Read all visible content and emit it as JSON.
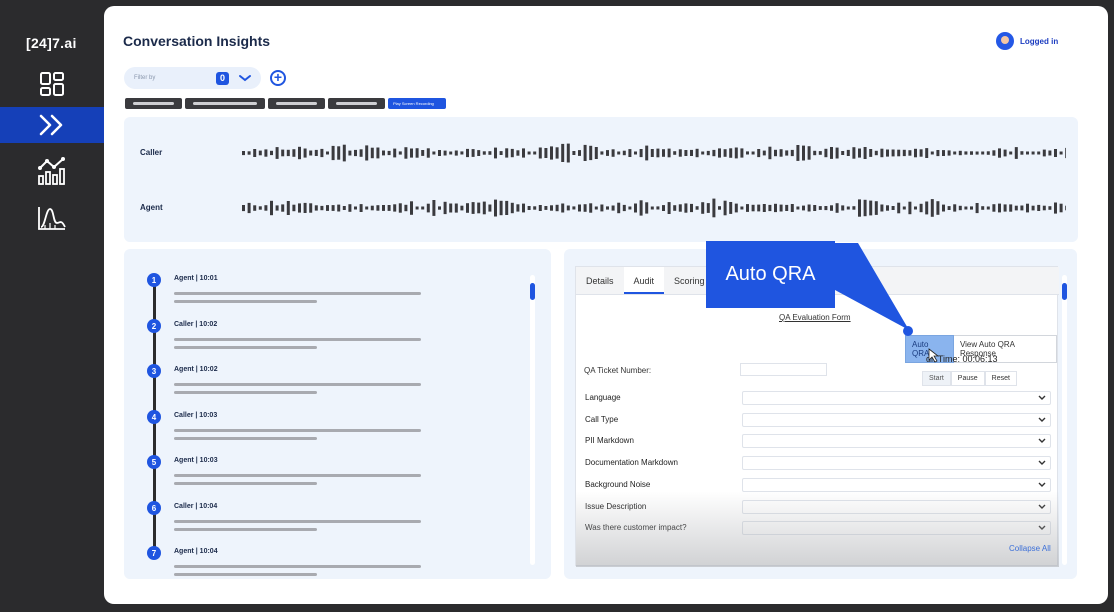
{
  "app": {
    "logo": "[24]7.ai"
  },
  "sidebar": {
    "items": [
      {
        "name": "dashboard",
        "icon": "grid-icon"
      },
      {
        "name": "conversations",
        "icon": "double-chevron-icon",
        "active": true
      },
      {
        "name": "analytics",
        "icon": "chart-trend-icon"
      },
      {
        "name": "distribution",
        "icon": "curve-chart-icon"
      }
    ]
  },
  "header": {
    "title": "Conversation Insights",
    "user_status": "Logged in"
  },
  "filter": {
    "label": "Filter by",
    "count": "0"
  },
  "chips": {
    "primary_label": "Play Screen Recording"
  },
  "waveform": {
    "caller_label": "Caller",
    "agent_label": "Agent"
  },
  "transcript": {
    "items": [
      {
        "num": "1",
        "speaker": "Agent | 10:01"
      },
      {
        "num": "2",
        "speaker": "Caller | 10:02"
      },
      {
        "num": "3",
        "speaker": "Agent | 10:02"
      },
      {
        "num": "4",
        "speaker": "Caller | 10:03"
      },
      {
        "num": "5",
        "speaker": "Agent | 10:03"
      },
      {
        "num": "6",
        "speaker": "Caller | 10:04"
      },
      {
        "num": "7",
        "speaker": "Agent | 10:04"
      }
    ]
  },
  "qa": {
    "tabs": [
      "Details",
      "Audit",
      "Scoring"
    ],
    "active_tab": "Audit",
    "form_title": "QA Evaluation Form",
    "auto_qra_button": "Auto QRA",
    "view_response_button": "View Auto QRA Response",
    "audit_time": "dit Time: 00:06:13",
    "controls": [
      "Start",
      "Pause",
      "Reset"
    ],
    "ticket_label": "QA Ticket Number:",
    "fields": [
      "Language",
      "Call Type",
      "PII Markdown",
      "Documentation Markdown",
      "Background Noise",
      "Issue Description",
      "Was there customer impact?"
    ],
    "collapse_all": "Collapse All"
  },
  "callout": {
    "text": "Auto QRA"
  },
  "colors": {
    "accent": "#1f55e0",
    "sidebar": "#2b2b2d",
    "panel": "#eef4fc"
  }
}
